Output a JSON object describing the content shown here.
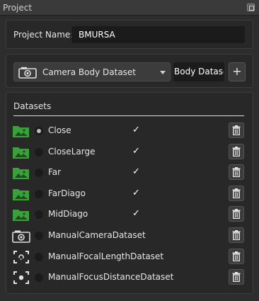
{
  "window": {
    "title": "Project"
  },
  "project": {
    "name_label": "Project Name:",
    "name_value": "BMURSA"
  },
  "dataset_selector": {
    "selected": "Camera Body Dataset",
    "body_button": "Body Dataset",
    "add_button": "+",
    "selected_icon": "camera-icon"
  },
  "datasets": {
    "header": "Datasets",
    "items": [
      {
        "label": "Close",
        "icon": "folder-image-icon",
        "active": true,
        "checked": true,
        "check_mark": "✓"
      },
      {
        "label": "CloseLarge",
        "icon": "folder-image-icon",
        "active": false,
        "checked": true,
        "check_mark": "✓"
      },
      {
        "label": "Far",
        "icon": "folder-image-icon",
        "active": false,
        "checked": true,
        "check_mark": "✓"
      },
      {
        "label": "FarDiago",
        "icon": "folder-image-icon",
        "active": false,
        "checked": true,
        "check_mark": "✓"
      },
      {
        "label": "MidDiago",
        "icon": "folder-image-icon",
        "active": false,
        "checked": true,
        "check_mark": "✓"
      },
      {
        "label": "ManualCameraDataset",
        "icon": "camera-icon",
        "active": false,
        "checked": false,
        "check_mark": ""
      },
      {
        "label": "ManualFocalLengthDataset",
        "icon": "focus-frame-icon",
        "active": false,
        "checked": false,
        "check_mark": ""
      },
      {
        "label": "ManualFocusDistanceDataset",
        "icon": "focus-target-icon",
        "active": false,
        "checked": false,
        "check_mark": ""
      }
    ]
  },
  "colors": {
    "accent_green": "#3aa13a",
    "background": "#2d2d2d",
    "panel": "#282828"
  }
}
